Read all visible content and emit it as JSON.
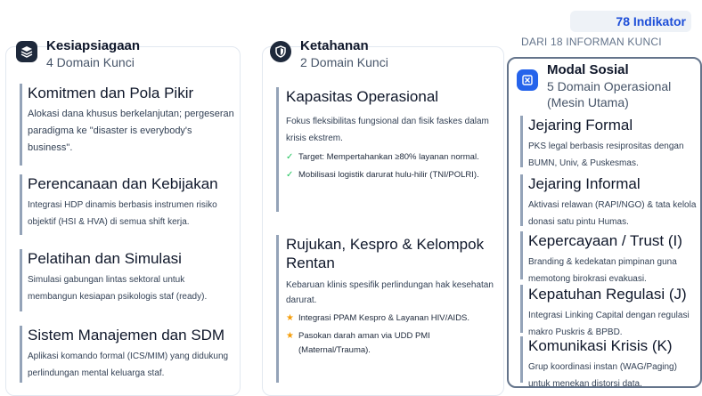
{
  "header": {
    "indikator_count": "78 Indikator",
    "informan": "DARI 18 INFORMAN KUNCI"
  },
  "kesiapsiagaan": {
    "title": "Kesiapsiagaan",
    "subtitle": "4 Domain Kunci",
    "icon": "layers-icon",
    "cards": [
      {
        "title": "Komitmen dan Pola Pikir",
        "body": "Alokasi dana khusus berkelanjutan; pergeseran paradigma ke \"disaster is everybody's business\"."
      },
      {
        "title": "Perencanaan dan Kebijakan",
        "body": "Integrasi HDP dinamis berbasis instrumen risiko objektif (HSI & HVA) di semua shift kerja."
      },
      {
        "title": "Pelatihan dan Simulasi",
        "body": "Simulasi gabungan lintas sektoral untuk membangun kesiapan psikologis staf (ready)."
      },
      {
        "title": "Sistem Manajemen dan SDM",
        "body": "Aplikasi komando formal (ICS/MIM) yang didukung perlindungan mental keluarga staf."
      }
    ]
  },
  "ketahanan": {
    "title": "Ketahanan",
    "subtitle": "2 Domain Kunci",
    "icon": "shield-icon",
    "cards": [
      {
        "title": "Kapasitas Operasional",
        "body": "Fokus fleksibilitas fungsional dan fisik faskes dalam krisis ekstrem.",
        "items": [
          "Target: Mempertahankan ≥80% layanan normal.",
          "Mobilisasi logistik darurat hulu-hilir (TNI/POLRI)."
        ]
      },
      {
        "title": "Rujukan, Kespro & Kelompok Rentan",
        "body": "Kebaruan klinis spesifik perlindungan hak kesehatan darurat.",
        "items": [
          "Integrasi PPAM Kespro & Layanan HIV/AIDS.",
          "Pasokan darah aman via UDD PMI (Maternal/Trauma)."
        ]
      }
    ]
  },
  "modal_sosial": {
    "title": "Modal Sosial",
    "subtitle": "5 Domain Operasional (Mesin Utama)",
    "icon": "network-icon",
    "cards": [
      {
        "title": "Jejaring Formal",
        "body": "PKS legal berbasis resiprositas dengan BUMN, Univ, & Puskesmas."
      },
      {
        "title": "Jejaring Informal",
        "body": "Aktivasi relawan (RAPI/NGO) & tata kelola donasi satu pintu Humas."
      },
      {
        "title": "Kepercayaan / Trust (I)",
        "body": "Branding & kedekatan pimpinan guna memotong birokrasi evakuasi."
      },
      {
        "title": "Kepatuhan Regulasi (J)",
        "body": "Integrasi Linking Capital dengan regulasi makro Puskris & BPBD."
      },
      {
        "title": "Komunikasi Krisis (K)",
        "body": "Grup koordinasi instan (WAG/Paging) untuk menekan distorsi data."
      }
    ]
  }
}
